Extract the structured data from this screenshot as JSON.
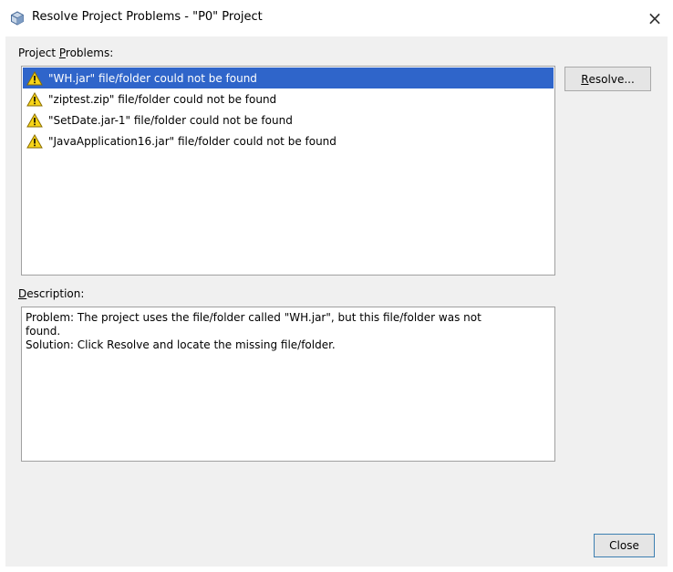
{
  "window": {
    "title": "Resolve Project Problems - \"P0\" Project",
    "close_glyph": "×"
  },
  "problems": {
    "label_prefix": "Project ",
    "label_mnemonic": "P",
    "label_suffix": "roblems:",
    "items": [
      {
        "text": "\"WH.jar\" file/folder could not be found",
        "icon": "warning-icon",
        "selected": true
      },
      {
        "text": "\"ziptest.zip\" file/folder could not be found",
        "icon": "warning-icon",
        "selected": false
      },
      {
        "text": "\"SetDate.jar-1\" file/folder could not be found",
        "icon": "warning-icon",
        "selected": false
      },
      {
        "text": "\"JavaApplication16.jar\" file/folder could not be found",
        "icon": "warning-icon",
        "selected": false
      }
    ]
  },
  "buttons": {
    "resolve_mnemonic": "R",
    "resolve_rest": "esolve...",
    "close": "Close"
  },
  "description": {
    "label_mnemonic": "D",
    "label_rest": "escription:",
    "lines": [
      "Problem: The project uses the file/folder called \"WH.jar\", but this file/folder was not",
      "found.",
      "Solution: Click Resolve and locate the missing file/folder."
    ]
  },
  "colors": {
    "selection": "#2f65ca",
    "dialog_bg": "#f0f0f0"
  }
}
